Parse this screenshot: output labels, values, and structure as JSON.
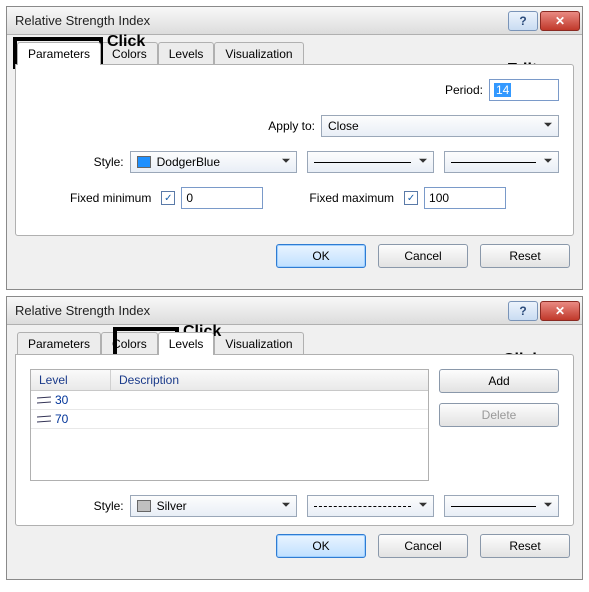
{
  "dialog1": {
    "title": "Relative Strength Index",
    "tabs": [
      "Parameters",
      "Colors",
      "Levels",
      "Visualization"
    ],
    "active_tab": 0
  },
  "dialog1_params": {
    "period_label": "Period:",
    "period_value": "14",
    "apply_label": "Apply to:",
    "apply_value": "Close",
    "style_label": "Style:",
    "style_color_name": "DodgerBlue",
    "style_color_hex": "#1e90ff",
    "fixed_min_label": "Fixed minimum",
    "fixed_min_checked": true,
    "fixed_min_value": "0",
    "fixed_max_label": "Fixed maximum",
    "fixed_max_checked": true,
    "fixed_max_value": "100"
  },
  "dialog2": {
    "title": "Relative Strength Index",
    "tabs": [
      "Parameters",
      "Colors",
      "Levels",
      "Visualization"
    ],
    "active_tab": 2
  },
  "dialog2_levels": {
    "col_level": "Level",
    "col_desc": "Description",
    "rows": [
      {
        "level": "30",
        "desc": ""
      },
      {
        "level": "70",
        "desc": ""
      }
    ],
    "add_label": "Add",
    "delete_label": "Delete",
    "style_label": "Style:",
    "style_color_name": "Silver",
    "style_color_hex": "#c0c0c0"
  },
  "buttons": {
    "ok": "OK",
    "cancel": "Cancel",
    "reset": "Reset"
  },
  "annotations": {
    "click": "Click",
    "edit": "Edit"
  }
}
